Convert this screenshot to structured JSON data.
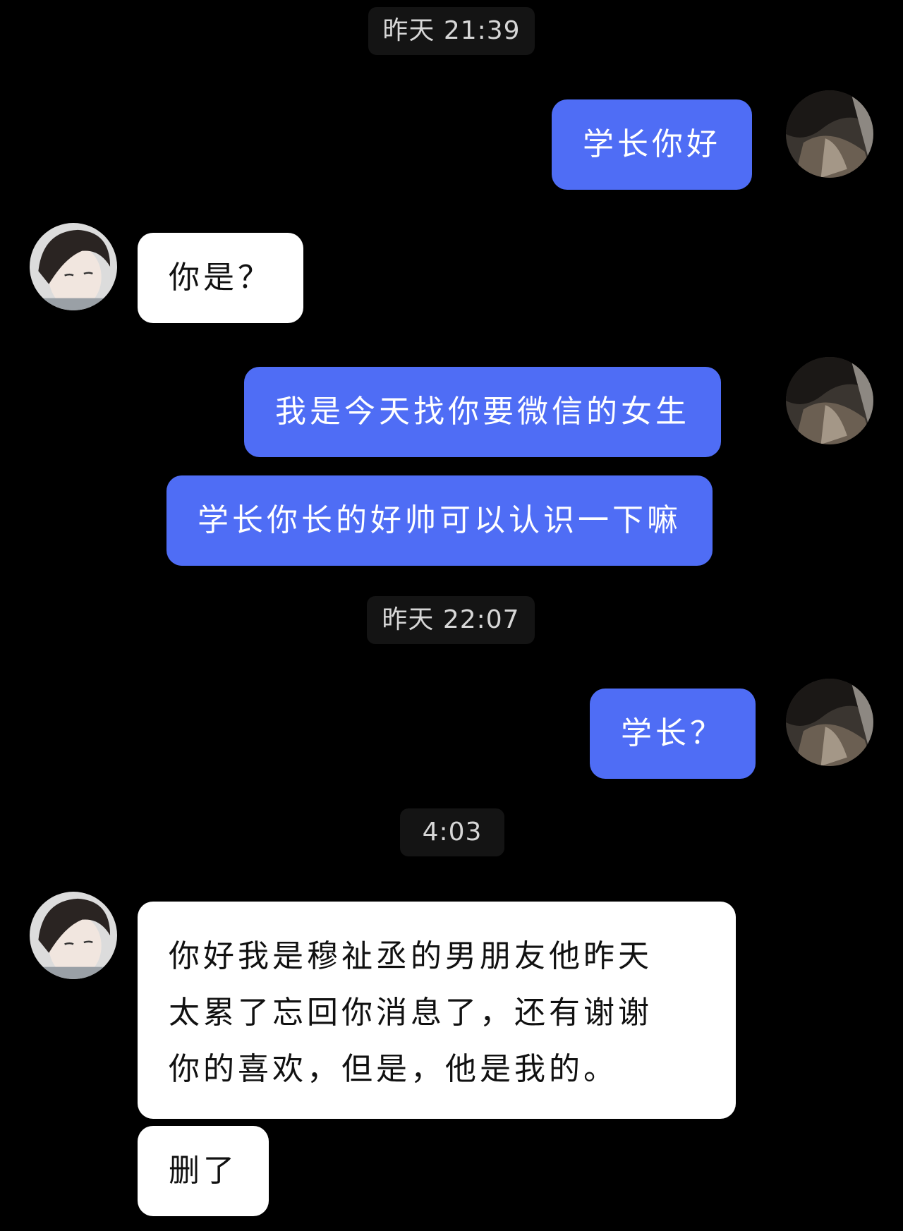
{
  "messages": {
    "time1": "昨天 21:39",
    "msg1": "学长你好",
    "msg2": "你是？",
    "msg3": "我是今天找你要微信的女生",
    "msg4": "学长你长的好帅可以认识一下嘛",
    "time2": "昨天 22:07",
    "msg5": "学长？",
    "time3": "4:03",
    "msg6_lines": [
      "你好我是穆祉丞的男朋友他昨天",
      "太累了忘回你消息了，还有谢谢",
      "你的喜欢，但是，他是我的。"
    ],
    "msg7": "删了"
  },
  "colors": {
    "background": "#000000",
    "outgoing_bubble": "#4f6df5",
    "incoming_bubble": "#ffffff",
    "time_pill": "#141414"
  }
}
